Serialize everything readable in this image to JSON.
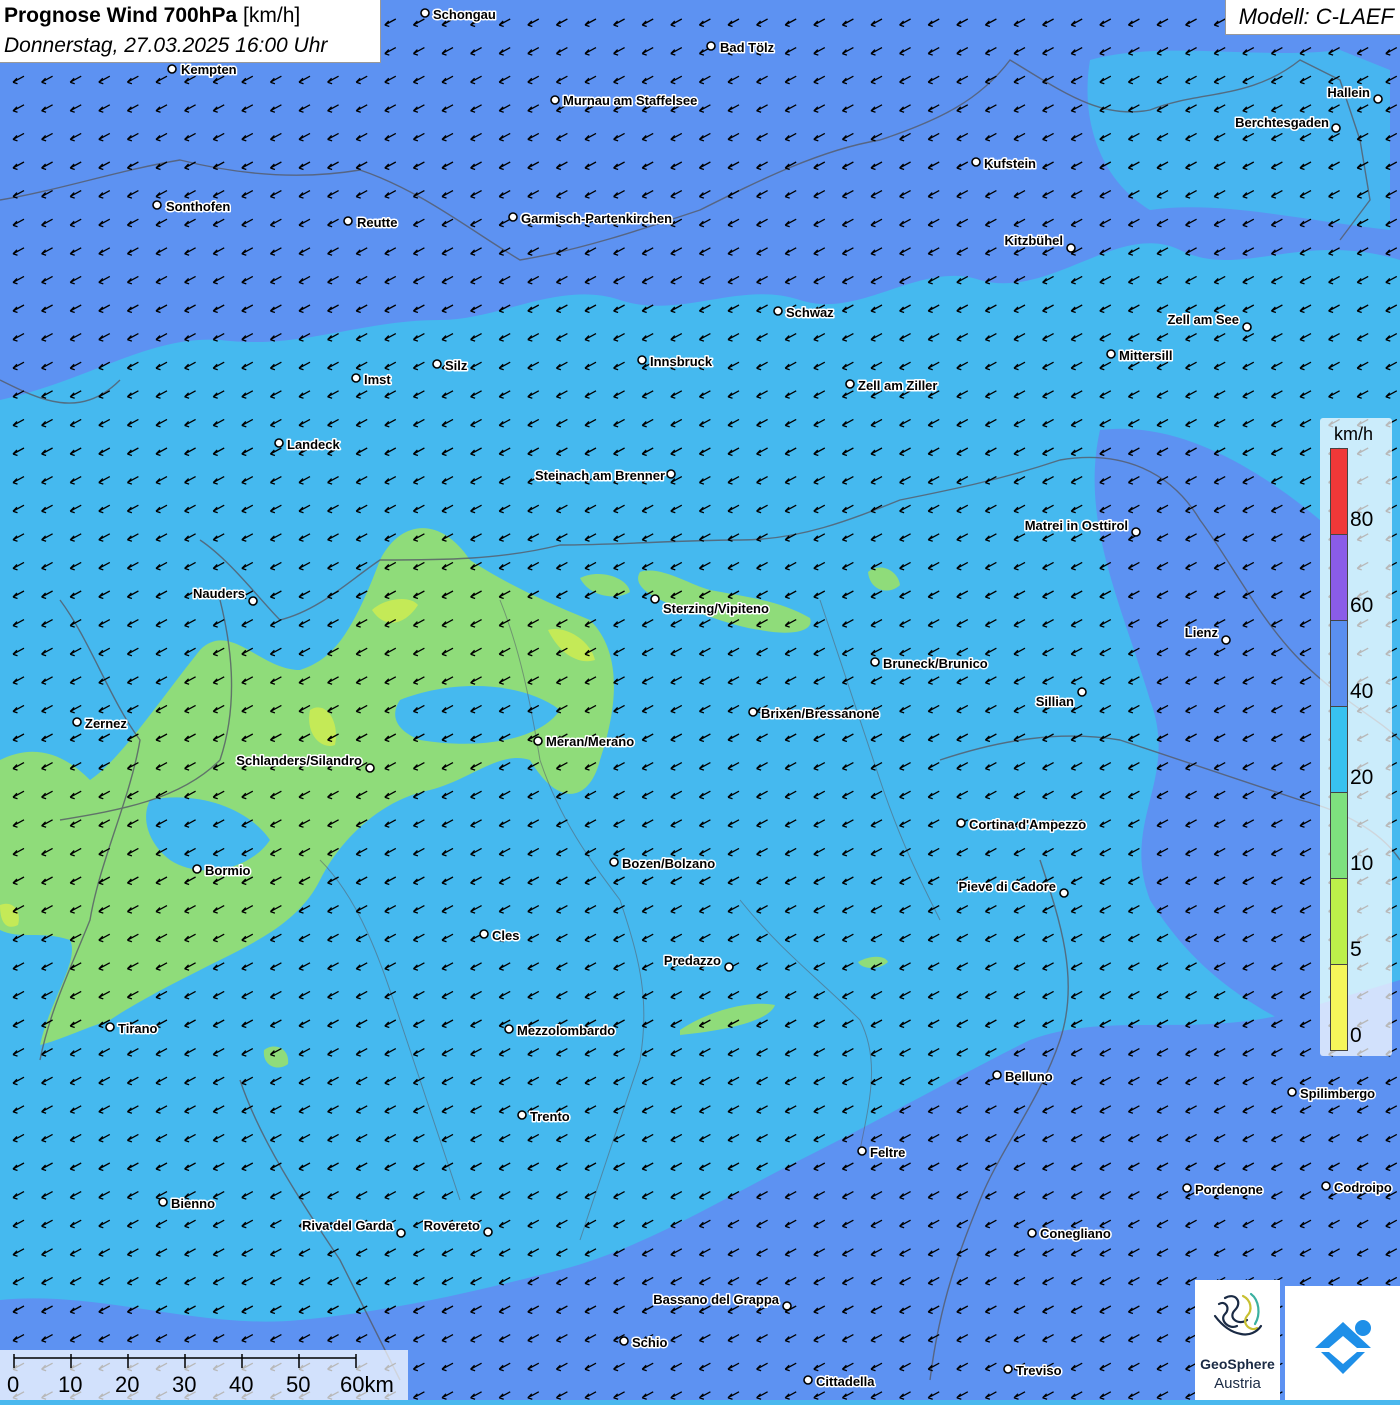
{
  "header": {
    "title_bold": "Prognose Wind 700hPa",
    "title_unit": "[km/h]",
    "datetime": "Donnerstag, 27.03.2025 16:00 Uhr"
  },
  "model": {
    "label": "Modell: C-LAEF"
  },
  "legend": {
    "unit": "km/h",
    "labels": [
      "80",
      "60",
      "40",
      "20",
      "10",
      "5",
      "0"
    ],
    "colors": [
      "#f03838",
      "#8a5ce8",
      "#5a8ff0",
      "#38c2f0",
      "#7ee07e",
      "#bdf04a",
      "#f6f65a"
    ]
  },
  "scale_bar": {
    "labels": [
      "0",
      "10",
      "20",
      "30",
      "40",
      "50",
      "60km"
    ]
  },
  "wind": {
    "direction": "from north-east",
    "typical_speed_kmh": "10-40"
  },
  "cities": [
    {
      "name": "Schongau"
    },
    {
      "name": "Bad Tölz"
    },
    {
      "name": "Kempten"
    },
    {
      "name": "Murnau am Staffelsee"
    },
    {
      "name": "Hallein"
    },
    {
      "name": "Berchtesgaden"
    },
    {
      "name": "Kufstein"
    },
    {
      "name": "Sonthofen"
    },
    {
      "name": "Reutte"
    },
    {
      "name": "Garmisch-Partenkirchen"
    },
    {
      "name": "Kitzbühel"
    },
    {
      "name": "Schwaz"
    },
    {
      "name": "Zell am See"
    },
    {
      "name": "Mittersill"
    },
    {
      "name": "Silz"
    },
    {
      "name": "Innsbruck"
    },
    {
      "name": "Imst"
    },
    {
      "name": "Zell am Ziller"
    },
    {
      "name": "Landeck"
    },
    {
      "name": "Steinach am Brenner"
    },
    {
      "name": "Matrei in Osttirol"
    },
    {
      "name": "Nauders"
    },
    {
      "name": "Sterzing/Vipiteno"
    },
    {
      "name": "Lienz"
    },
    {
      "name": "Bruneck/Brunico"
    },
    {
      "name": "Sillian"
    },
    {
      "name": "Brixen/Bressanone"
    },
    {
      "name": "Zernez"
    },
    {
      "name": "Meran/Merano"
    },
    {
      "name": "Schlanders/Silandro"
    },
    {
      "name": "Cortina d'Ampezzo"
    },
    {
      "name": "Bozen/Bolzano"
    },
    {
      "name": "Bormio"
    },
    {
      "name": "Pieve di Cadore"
    },
    {
      "name": "Cles"
    },
    {
      "name": "Predazzo"
    },
    {
      "name": "Tirano"
    },
    {
      "name": "Mezzolombardo"
    },
    {
      "name": "Belluno"
    },
    {
      "name": "Spilimbergo"
    },
    {
      "name": "Trento"
    },
    {
      "name": "Feltre"
    },
    {
      "name": "Pordenone"
    },
    {
      "name": "Codroipo"
    },
    {
      "name": "Bienno"
    },
    {
      "name": "Riva del Garda"
    },
    {
      "name": "Rovereto"
    },
    {
      "name": "Conegliano"
    },
    {
      "name": "Bassano del Grappa"
    },
    {
      "name": "Schio"
    },
    {
      "name": "Treviso"
    },
    {
      "name": "Cittadella"
    }
  ],
  "logos": {
    "geosphere_line1": "GeoSphere",
    "geosphere_line2": "Austria"
  }
}
